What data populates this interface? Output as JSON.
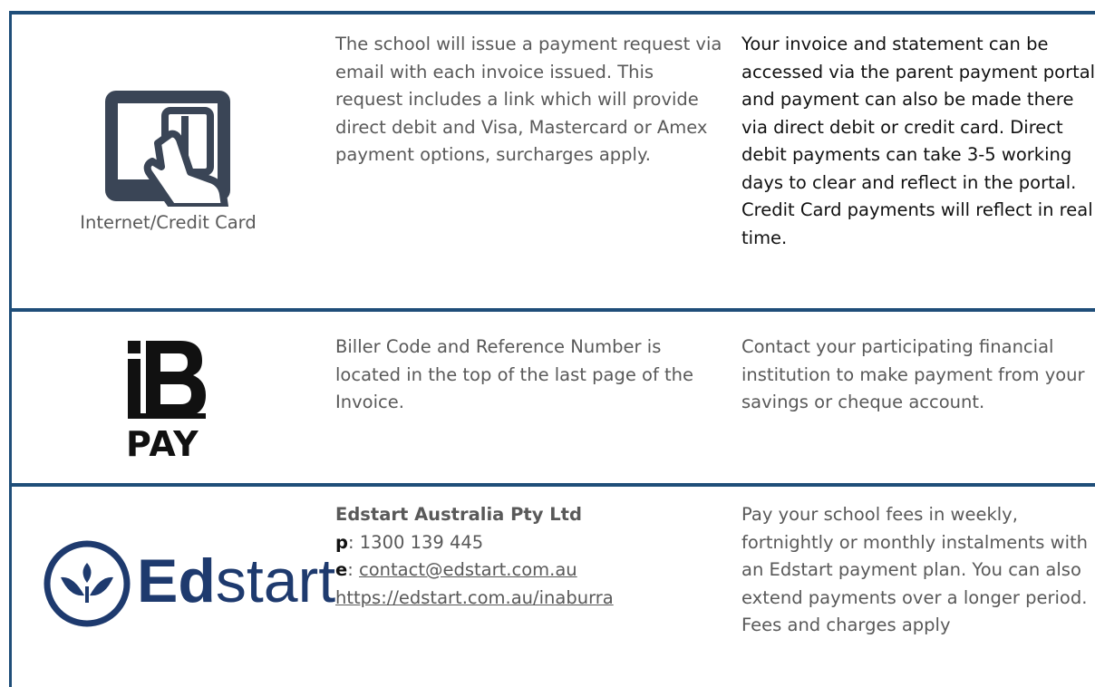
{
  "rows": [
    {
      "method_label": "Internet/Credit Card",
      "icon": "tablet-card-hand-icon",
      "how": "The school will issue a payment request via email with each invoice issued. This request includes a link which will provide direct debit and Visa, Mastercard or Amex payment options, surcharges apply.",
      "details": "Your invoice and statement can be accessed via the parent payment portal and payment can also be made there via direct debit or credit card. Direct debit payments can take 3-5 working days to clear and reflect in the portal. Credit Card payments will reflect in real time."
    },
    {
      "icon": "bpay-logo",
      "logo_text": "PAY",
      "how": "Biller Code and Reference Number is located in the top of the last page of the Invoice.",
      "details": "Contact your participating financial institution to make payment from your savings or cheque account."
    },
    {
      "icon": "edstart-logo",
      "logo_text_bold": "Ed",
      "logo_text_rest": "start",
      "company": "Edstart Australia Pty Ltd",
      "phone_label": "p",
      "phone": "1300 139 445",
      "email_label": "e",
      "email": "contact@edstart.com.au",
      "url": "https://edstart.com.au/inaburra",
      "details": "Pay your school fees in weekly, fortnightly or monthly instalments with an Edstart payment plan. You can also extend payments over a longer period. Fees and charges apply"
    }
  ],
  "colors": {
    "border": "#1f4e79",
    "text_gray": "#595959",
    "text_dark": "#111111",
    "logo_navy": "#1e3a6e",
    "icon_slate": "#3a4556"
  }
}
